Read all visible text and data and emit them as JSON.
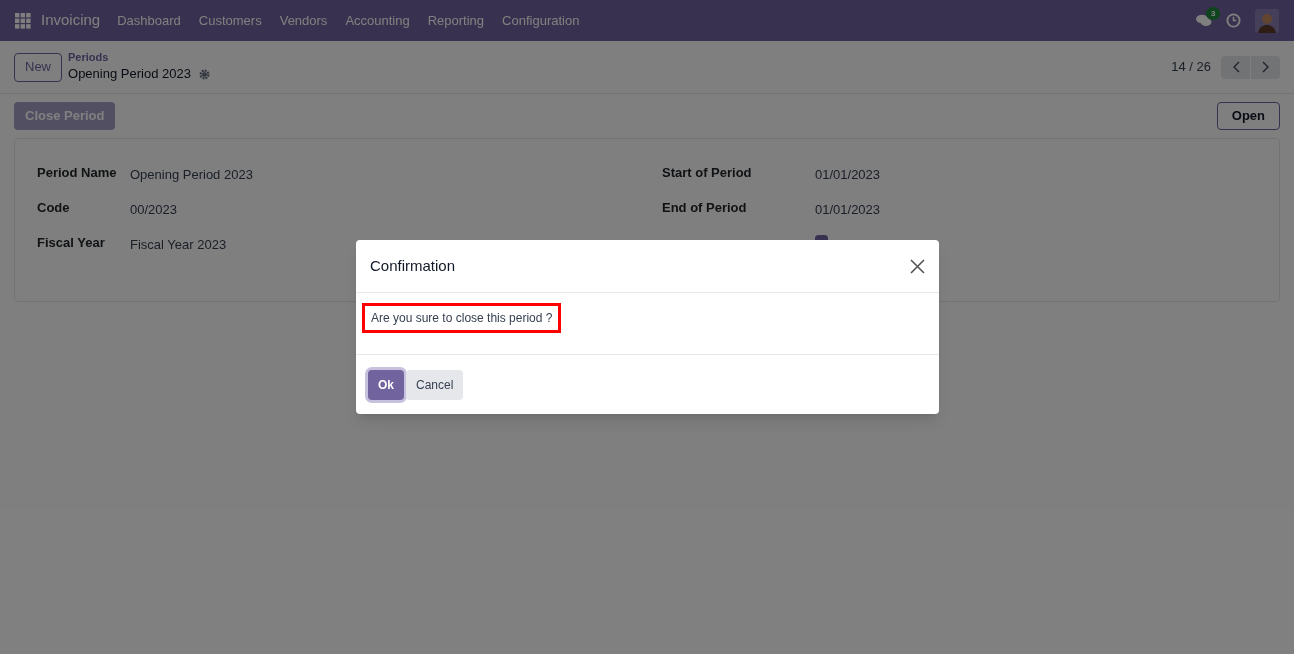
{
  "navbar": {
    "app_name": "Invoicing",
    "menu": [
      "Dashboard",
      "Customers",
      "Vendors",
      "Accounting",
      "Reporting",
      "Configuration"
    ],
    "messages_badge": "3"
  },
  "control_panel": {
    "new_button": "New",
    "breadcrumb": "Periods",
    "record_title": "Opening Period 2023",
    "pager": "14 / 26"
  },
  "actions": {
    "left": {
      "label": "Close Period",
      "disabled": true
    },
    "right": {
      "label": "Open",
      "disabled": false
    }
  },
  "form": {
    "left_fields": [
      {
        "label": "Period Name",
        "value": "Opening Period 2023"
      },
      {
        "label": "Code",
        "value": "00/2023"
      },
      {
        "label": "Fiscal Year",
        "value": "Fiscal Year 2023"
      }
    ],
    "right_fields": [
      {
        "label": "Start of Period",
        "value": "01/01/2023",
        "kind": "text"
      },
      {
        "label": "End of Period",
        "value": "01/01/2023",
        "kind": "text"
      },
      {
        "kind": "checkbox",
        "checked": true
      }
    ]
  },
  "dialog": {
    "title": "Confirmation",
    "message": "Are you sure to close this period ?",
    "highlighted": true,
    "buttons": [
      {
        "label": "Ok",
        "primary": true
      },
      {
        "label": "Cancel",
        "primary": false
      }
    ]
  }
}
